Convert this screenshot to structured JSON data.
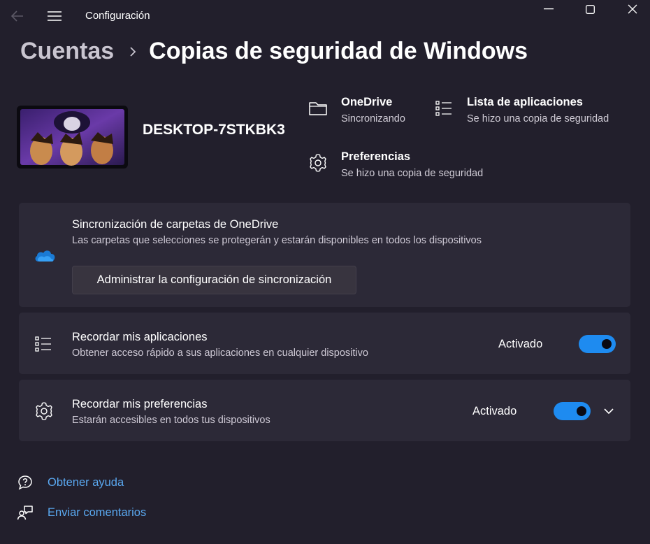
{
  "window": {
    "title": "Configuración",
    "back_icon": "back-arrow-icon",
    "menu_icon": "hamburger-menu-icon",
    "controls": [
      "minimize-icon",
      "maximize-icon",
      "close-icon"
    ]
  },
  "breadcrumb": {
    "parent": "Cuentas",
    "current": "Copias de seguridad de Windows"
  },
  "device": {
    "name": "DESKTOP-7STKBK3"
  },
  "summary": {
    "onedrive": {
      "title": "OneDrive",
      "status": "Sincronizando",
      "icon": "folder-icon"
    },
    "apps": {
      "title": "Lista de aplicaciones",
      "status": "Se hizo una copia de seguridad",
      "icon": "app-list-icon"
    },
    "prefs": {
      "title": "Preferencias",
      "status": "Se hizo una copia de seguridad",
      "icon": "gear-icon"
    }
  },
  "onedrive_card": {
    "title": "Sincronización de carpetas de OneDrive",
    "description": "Las carpetas que selecciones se protegerán y estarán disponibles en todos los dispositivos",
    "button": "Administrar la configuración de sincronización",
    "icon": "onedrive-cloud-icon"
  },
  "apps_card": {
    "title": "Recordar mis aplicaciones",
    "description": "Obtener acceso rápido a sus aplicaciones en cualquier dispositivo",
    "state": "Activado",
    "toggle_on": true,
    "icon": "app-list-icon"
  },
  "prefs_card": {
    "title": "Recordar mis preferencias",
    "description": "Estarán accesibles en todos tus dispositivos",
    "state": "Activado",
    "toggle_on": true,
    "icon": "gear-icon"
  },
  "links": {
    "help": "Obtener ayuda",
    "feedback": "Enviar comentarios"
  },
  "colors": {
    "background": "#221f2c",
    "card": "#2c2937",
    "accent": "#1e8bf0",
    "link": "#5aa8f0"
  }
}
